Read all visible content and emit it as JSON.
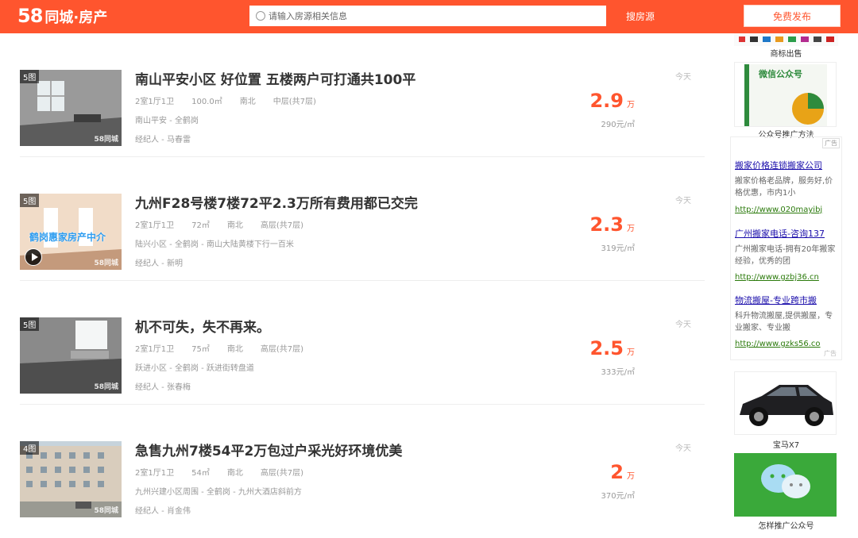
{
  "header": {
    "logo_num": "58",
    "logo_text": "同城·房产",
    "search_placeholder": "请输入房源相关信息",
    "search_button": "搜房源",
    "publish_button": "免费发布"
  },
  "listings": [
    {
      "thumb_count": "5图",
      "watermark": "58同城",
      "title": "南山平安小区 好位置 五楼两户可打通共100平",
      "layout": "2室1厅1卫",
      "area": "100.0㎡",
      "orientation": "南北",
      "floor": "中层(共7层)",
      "address": "南山平安 - 全鹤岗",
      "agent": "经纪人 - 马春雷",
      "price": "2.9",
      "price_unit": "万",
      "unit_price": "290元/㎡",
      "date": "今天"
    },
    {
      "thumb_count": "5图",
      "watermark": "58同城",
      "overlay": "鹤岗惠家房产中介",
      "title": "九州F28号楼7楼72平2.3万所有费用都已交完",
      "layout": "2室1厅1卫",
      "area": "72㎡",
      "orientation": "南北",
      "floor": "高层(共7层)",
      "address": "陆兴小区 - 全鹤岗 - 南山大陆黄楼下行一百米",
      "agent": "经纪人 - 新明",
      "price": "2.3",
      "price_unit": "万",
      "unit_price": "319元/㎡",
      "date": "今天"
    },
    {
      "thumb_count": "5图",
      "watermark": "58同城",
      "title": "机不可失，失不再来。",
      "layout": "2室1厅1卫",
      "area": "75㎡",
      "orientation": "南北",
      "floor": "高层(共7层)",
      "address": "跃进小区 - 全鹤岗 - 跃进街转盘道",
      "agent": "经纪人 - 张春梅",
      "price": "2.5",
      "price_unit": "万",
      "unit_price": "333元/㎡",
      "date": "今天"
    },
    {
      "thumb_count": "4图",
      "watermark": "58同城",
      "title": "急售九州7楼54平2万包过户采光好环境优美",
      "layout": "2室1厅1卫",
      "area": "54㎡",
      "orientation": "南北",
      "floor": "高层(共7层)",
      "address": "九州兴建小区周围 - 全鹤岗 - 九州大酒店斜前方",
      "agent": "经纪人 - 肖金伟",
      "price": "2",
      "price_unit": "万",
      "unit_price": "370元/㎡",
      "date": "今天"
    }
  ],
  "sidebar": {
    "ad1_caption": "商标出售",
    "ad2_caption": "公众号推广方法",
    "ad2_book_title": "微信公众号",
    "ad_badge": "广告",
    "text_ads": [
      {
        "title": "搬家价格连锁搬家公司",
        "desc": "搬家价格老品牌，服务好,价格优惠，市内1小",
        "url": "http://www.020mayibj"
      },
      {
        "title": "广州搬家电话-咨询137",
        "desc": "广州搬家电话-拥有20年搬家经验，优秀的团",
        "url": "http://www.gzbj36.cn"
      },
      {
        "title": "物流搬屋-专业跨市搬",
        "desc": "科升物流搬屋,提供搬屋，专业搬家、专业搬",
        "url": "http://www.gzks56.co"
      }
    ],
    "ad3_caption": "宝马X7",
    "ad4_caption": "怎样推广公众号"
  }
}
